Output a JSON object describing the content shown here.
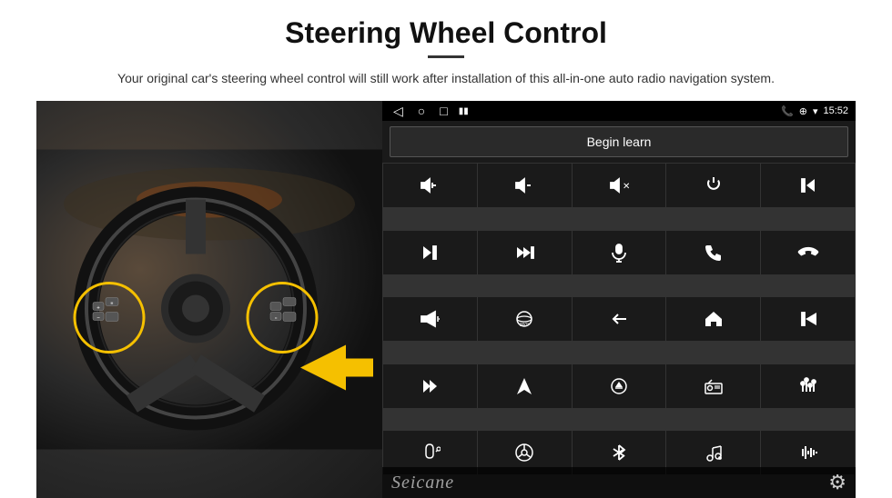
{
  "page": {
    "title": "Steering Wheel Control",
    "subtitle": "Your original car's steering wheel control will still work after installation of this all-in-one auto radio navigation system.",
    "divider": true
  },
  "status_bar": {
    "nav_back": "◁",
    "nav_home_circle": "○",
    "nav_square": "□",
    "signal_icon": "▪▪",
    "phone_icon": "📞",
    "location_icon": "⊕",
    "wifi_icon": "▼",
    "time": "15:52"
  },
  "begin_learn": {
    "label": "Begin learn"
  },
  "grid": {
    "rows": [
      [
        "vol+",
        "vol-",
        "mute",
        "power",
        "prev-track"
      ],
      [
        "next-track",
        "ff-skip",
        "mic",
        "phone",
        "hang-up"
      ],
      [
        "horn",
        "360cam",
        "back",
        "home",
        "prev"
      ],
      [
        "fast-forward",
        "navigation",
        "eject",
        "radio",
        "equalizer"
      ],
      [
        "mic2",
        "steering",
        "bluetooth",
        "music",
        "waveform"
      ]
    ]
  },
  "seicane": {
    "logo": "Seicane"
  },
  "icons": {
    "gear": "⚙"
  }
}
